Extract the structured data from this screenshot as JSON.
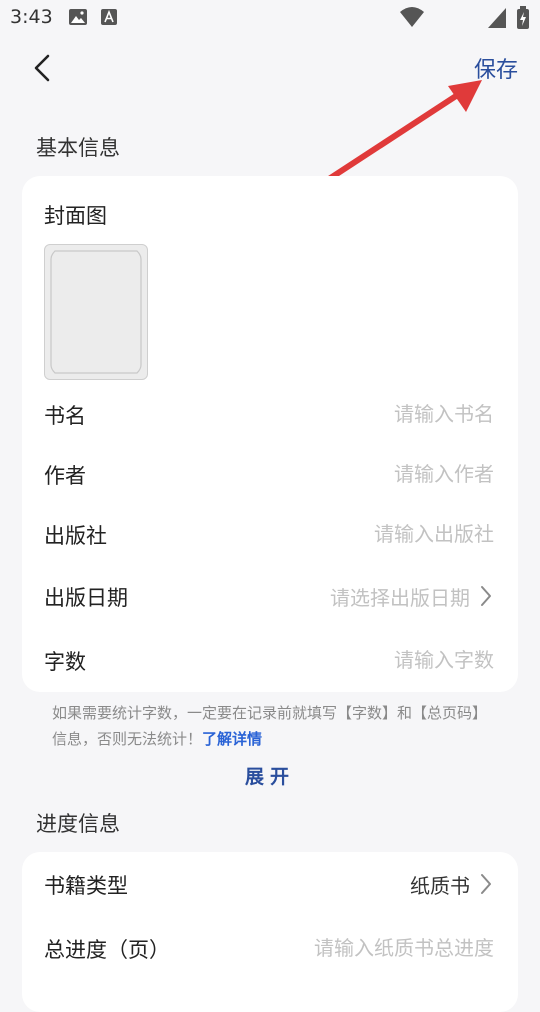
{
  "status_bar": {
    "time": "3:43"
  },
  "header": {
    "save_label": "保存"
  },
  "basic_info": {
    "section_title": "基本信息",
    "cover_label": "封面图",
    "fields": {
      "title": {
        "label": "书名",
        "placeholder": "请输入书名"
      },
      "author": {
        "label": "作者",
        "placeholder": "请输入作者"
      },
      "publisher": {
        "label": "出版社",
        "placeholder": "请输入出版社"
      },
      "publish_date": {
        "label": "出版日期",
        "placeholder": "请选择出版日期"
      },
      "word_count": {
        "label": "字数",
        "placeholder": "请输入字数"
      }
    }
  },
  "hint": {
    "text": "如果需要统计字数，一定要在记录前就填写【字数】和【总页码】信息，否则无法统计！",
    "link": "了解详情"
  },
  "expand_label": "展开",
  "progress_info": {
    "section_title": "进度信息",
    "book_type": {
      "label": "书籍类型",
      "value": "纸质书"
    },
    "total_progress": {
      "label": "总进度（页）",
      "placeholder": "请输入纸质书总进度"
    }
  },
  "colors": {
    "accent": "#2a4e9d",
    "link": "#2a63d6",
    "annotation_arrow": "#e03a3a",
    "page_background": "#f6f6f8"
  }
}
